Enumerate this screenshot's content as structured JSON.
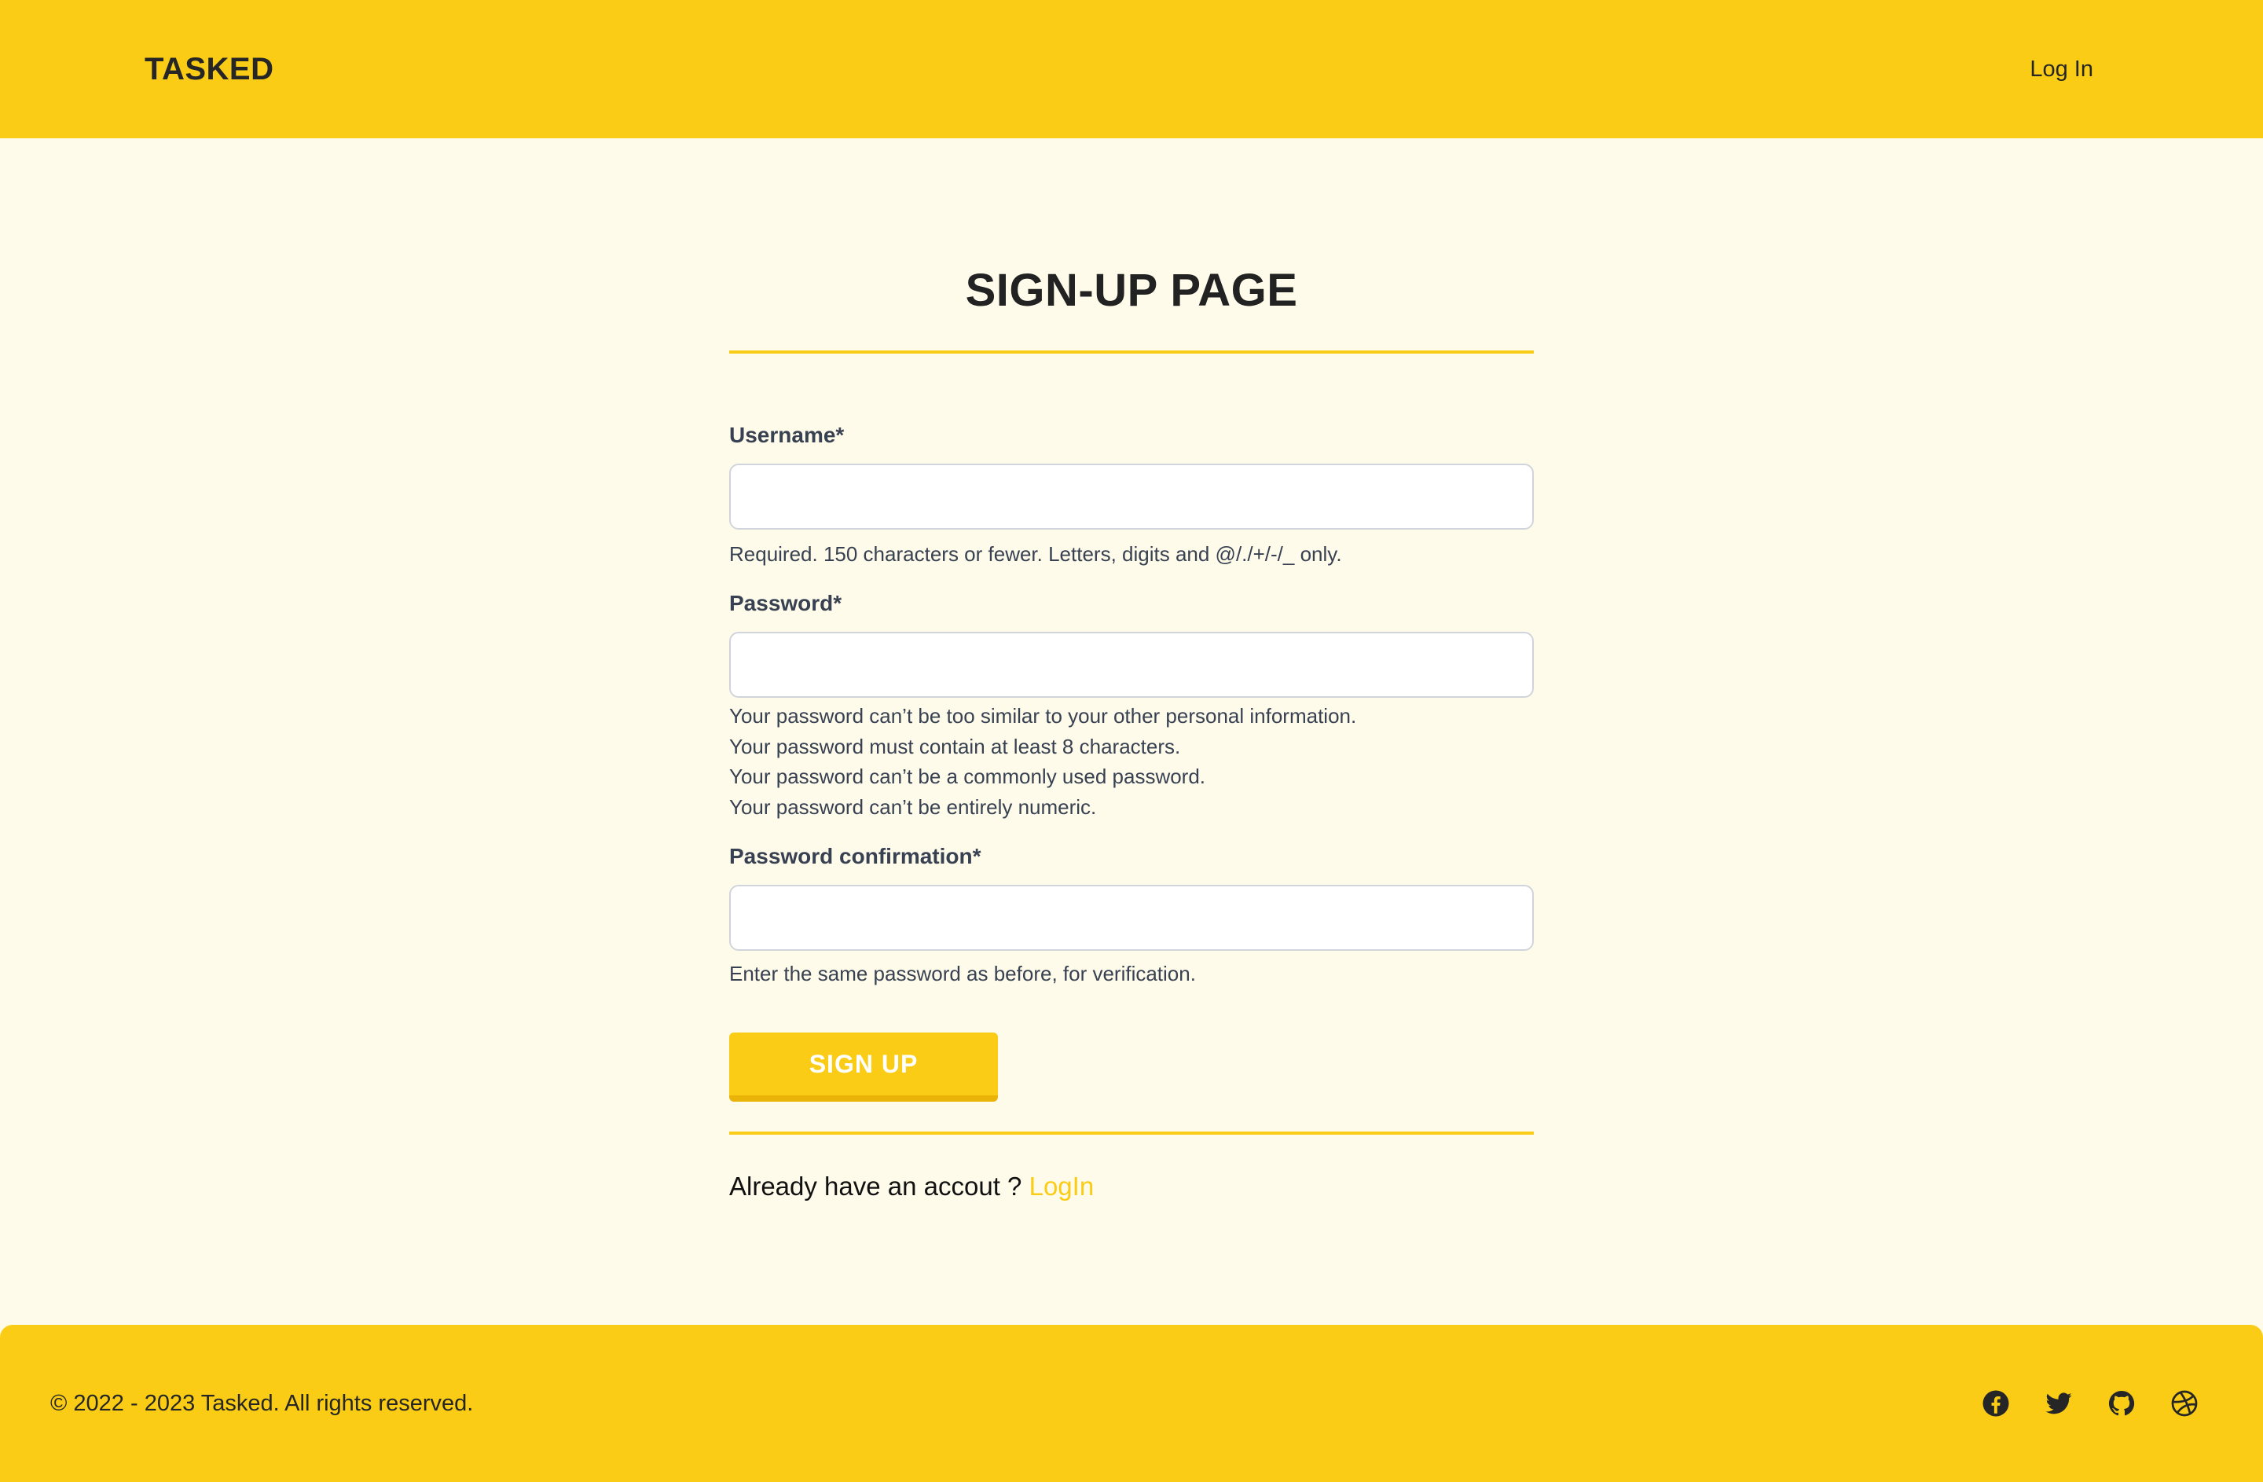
{
  "header": {
    "brand": "TASKED",
    "login_link": "Log In"
  },
  "main": {
    "title": "SIGN-UP PAGE",
    "fields": {
      "username": {
        "label": "Username*",
        "value": "",
        "help": "Required. 150 characters or fewer. Letters, digits and @/./+/-/_ only."
      },
      "password": {
        "label": "Password*",
        "value": "",
        "help": [
          "Your password can’t be too similar to your other personal information.",
          "Your password must contain at least 8 characters.",
          "Your password can’t be a commonly used password.",
          "Your password can’t be entirely numeric."
        ]
      },
      "password_confirmation": {
        "label": "Password confirmation*",
        "value": "",
        "help": "Enter the same password as before, for verification."
      }
    },
    "submit_label": "SIGN UP",
    "already_text": "Already have an accout ?",
    "login_link": "LogIn"
  },
  "footer": {
    "copyright": "© 2022 - 2023 Tasked. All rights reserved.",
    "social_icons": [
      "facebook-icon",
      "twitter-icon",
      "github-icon",
      "dribbble-icon"
    ]
  },
  "colors": {
    "accent": "#facc15",
    "accent_dark": "#eab308",
    "background": "#fffbea",
    "text": "#262626"
  }
}
